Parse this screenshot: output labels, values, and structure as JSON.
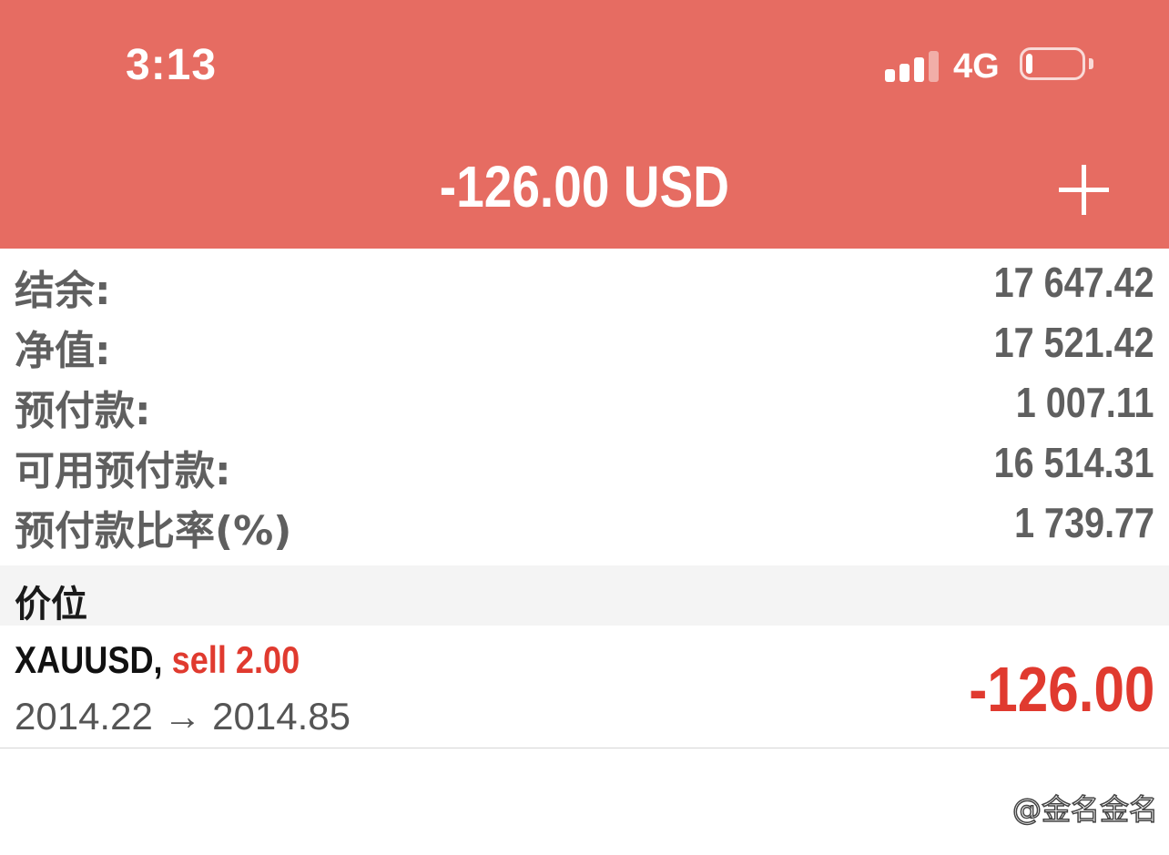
{
  "status_bar": {
    "time": "3:13",
    "network": "4G",
    "signal_bars_active": 3,
    "signal_bars_total": 4,
    "battery_level": 0.12
  },
  "header": {
    "title": "-126.00 USD",
    "add_icon": "plus-icon",
    "background_color": "#e66c62"
  },
  "summary": [
    {
      "label": "结余:",
      "value": "17 647.42"
    },
    {
      "label": "净值:",
      "value": "17 521.42"
    },
    {
      "label": "预付款:",
      "value": "1 007.11"
    },
    {
      "label": "可用预付款:",
      "value": "16 514.31"
    },
    {
      "label": "预付款比率(%)",
      "value": "1 739.77"
    }
  ],
  "positions_section": {
    "title": "价位"
  },
  "positions": [
    {
      "symbol": "XAUUSD,",
      "type": "sell 2.00",
      "prices": "2014.22 → 2014.85",
      "profit": "-126.00"
    }
  ],
  "colors": {
    "loss": "#e03a2f",
    "text_gray": "#5f5f5f"
  },
  "watermark": "@金名金名"
}
